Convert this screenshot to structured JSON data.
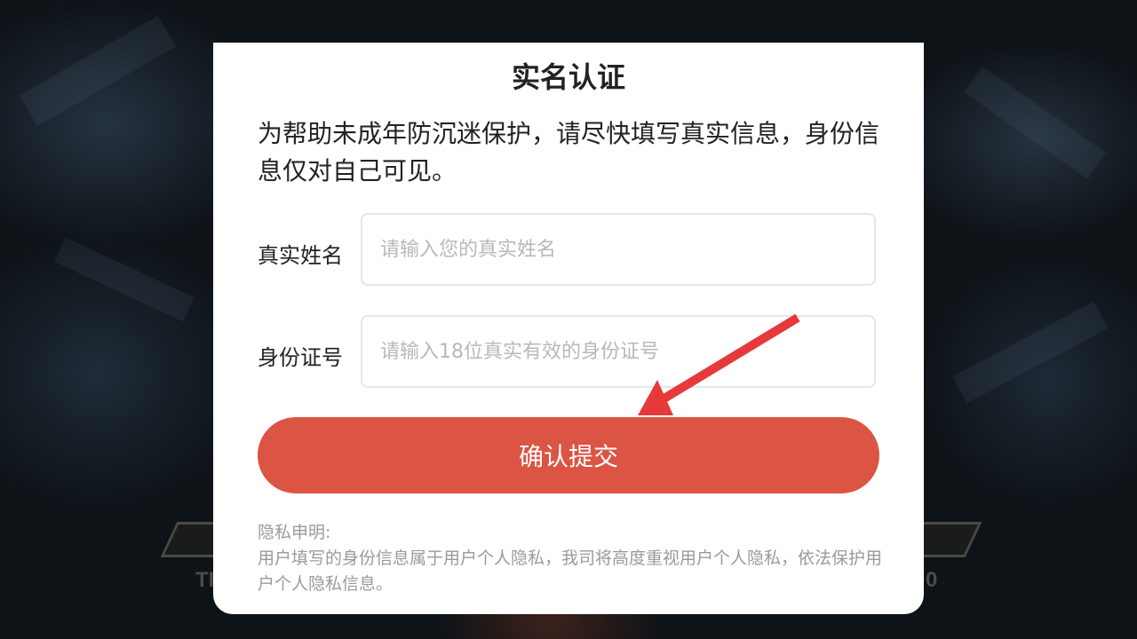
{
  "background": {
    "left_badge_text": "TI",
    "right_badge_text": "0"
  },
  "dialog": {
    "title": "实名认证",
    "notice": "为帮助未成年防沉迷保护，请尽快填写真实信息，身份信息仅对自己可见。",
    "name_field": {
      "label": "真实姓名",
      "value": "",
      "placeholder": "请输入您的真实姓名"
    },
    "id_field": {
      "label": "身份证号",
      "value": "",
      "placeholder": "请输入18位真实有效的身份证号"
    },
    "submit_label": "确认提交",
    "privacy_heading": "隐私申明:",
    "privacy_text": "用户填写的身份信息属于用户个人隐私，我司将高度重视用户个人隐私，依法保护用户个人隐私信息。"
  },
  "colors": {
    "accent": "#dc5444",
    "annotation_arrow": "#e63a3a",
    "placeholder": "#b8b8b8",
    "privacy_text": "#9a9a9a"
  },
  "icons": {
    "annotation": "red-arrow-icon"
  }
}
